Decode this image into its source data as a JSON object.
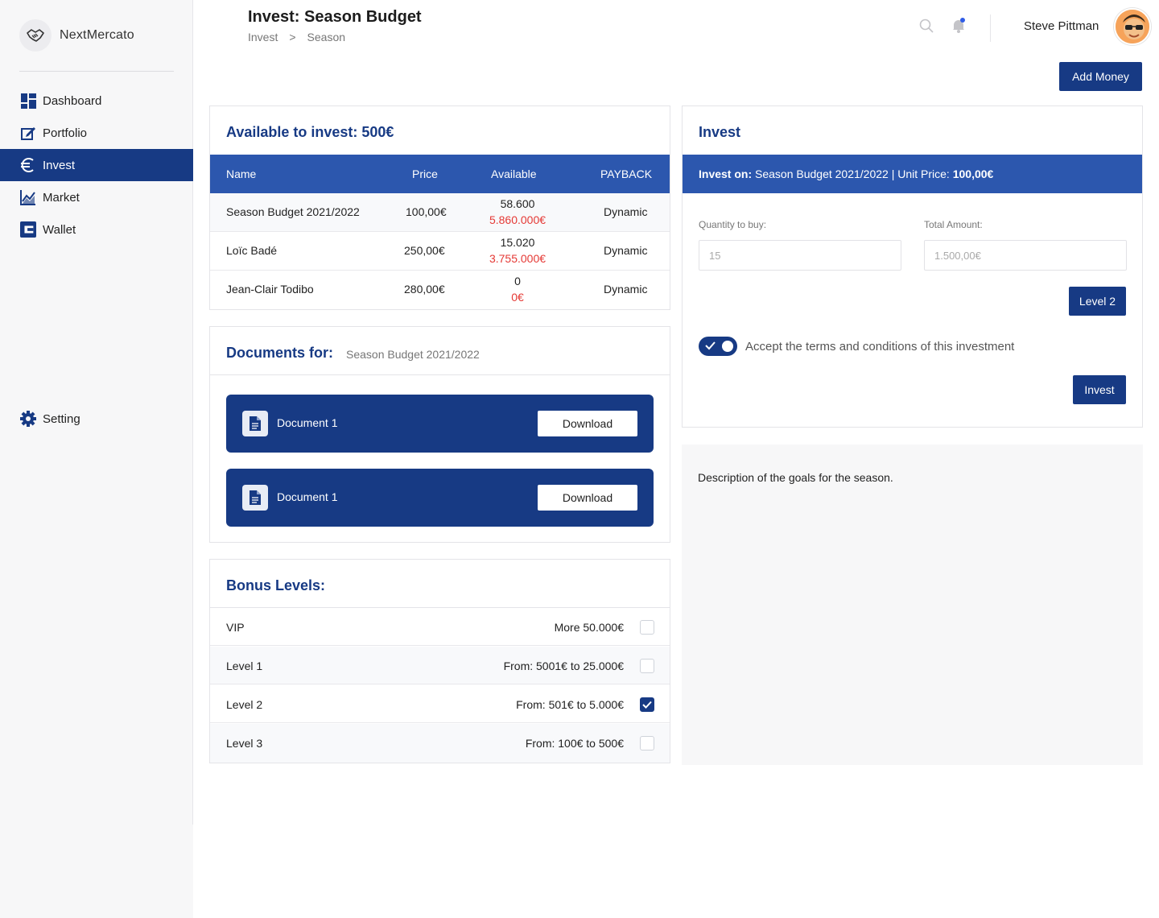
{
  "brand": {
    "name": "NextMercato",
    "logo_icon": "handshake-icon"
  },
  "sidebar": {
    "items": [
      {
        "label": "Dashboard",
        "icon": "dashboard-icon"
      },
      {
        "label": "Portfolio",
        "icon": "edit-icon"
      },
      {
        "label": "Invest",
        "icon": "euro-icon",
        "active": true
      },
      {
        "label": "Market",
        "icon": "chart-icon"
      },
      {
        "label": "Wallet",
        "icon": "wallet-icon"
      }
    ],
    "setting": {
      "label": "Setting",
      "icon": "gear-icon"
    }
  },
  "header": {
    "title": "Invest: Season Budget",
    "breadcrumb": [
      "Invest",
      ">",
      "Season"
    ],
    "user_name": "Steve Pittman"
  },
  "add_money_label": "Add Money",
  "available": {
    "title": "Available to invest: 500€",
    "columns": [
      "Name",
      "Price",
      "Available",
      "PAYBACK"
    ],
    "rows": [
      {
        "name": "Season Budget 2021/2022",
        "price": "100,00€",
        "units": "58.600",
        "amount": "5.860.000€",
        "payback": "Dynamic"
      },
      {
        "name": "Loïc Badé",
        "price": "250,00€",
        "units": "15.020",
        "amount": "3.755.000€",
        "payback": "Dynamic"
      },
      {
        "name": "Jean-Clair Todibo",
        "price": "280,00€",
        "units": "0",
        "amount": "0€",
        "payback": "Dynamic"
      }
    ]
  },
  "documents": {
    "title": "Documents for:",
    "subtitle": "Season Budget 2021/2022",
    "items": [
      {
        "name": "Document 1",
        "button": "Download"
      },
      {
        "name": "Document 1",
        "button": "Download"
      }
    ]
  },
  "bonus": {
    "title": "Bonus Levels:",
    "rows": [
      {
        "level": "VIP",
        "range": "More 50.000€",
        "checked": false
      },
      {
        "level": "Level 1",
        "range": "From: 5001€ to 25.000€",
        "checked": false
      },
      {
        "level": "Level 2",
        "range": "From: 501€ to 5.000€",
        "checked": true
      },
      {
        "level": "Level 3",
        "range": "From: 100€ to 500€",
        "checked": false
      }
    ]
  },
  "invest": {
    "title": "Invest",
    "bar_label": "Invest on:",
    "bar_text": " Season Budget 2021/2022 | Unit Price: ",
    "bar_price": "100,00€",
    "quantity_label": "Quantity to buy:",
    "quantity_value": "15",
    "total_label": "Total Amount:",
    "total_value": "1.500,00€",
    "level_button": "Level 2",
    "terms_label": "Accept the terms and conditions of this investment",
    "terms_accepted": true,
    "invest_button": "Invest"
  },
  "description": "Description of the goals for the season.",
  "colors": {
    "primary": "#173a84",
    "table_header": "#2c57ae",
    "negative": "#e53935",
    "notification_dot": "#2f5ce6"
  }
}
